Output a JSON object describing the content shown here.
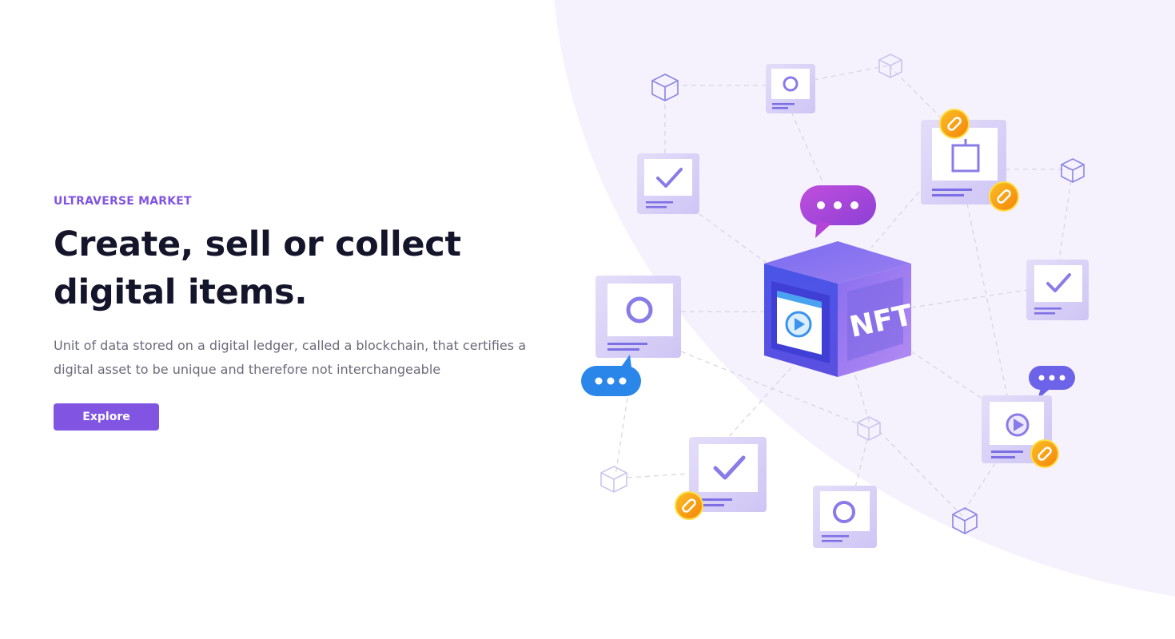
{
  "hero": {
    "eyebrow": "ULTRAVERSE MARKET",
    "headline_line1": "Create, sell or collect",
    "headline_line2": "digital items.",
    "description": "Unit of data stored on a digital ledger, called a blockchain, that certifies a digital asset to be unique and therefore not interchangeable",
    "explore_label": "Explore"
  },
  "illustration": {
    "cube_label": "NFT"
  },
  "colors": {
    "accent": "#8155e2",
    "headline": "#14142b",
    "body_text": "#6b6b7b",
    "background_blob": "#f5f2fd",
    "chat_blue": "#2b86ea",
    "chat_magenta": "#b545d6",
    "coin_orange": "#f7a21b"
  },
  "icons": [
    "chat-bubble-icon",
    "play-icon",
    "checkmark-icon",
    "circle-icon",
    "link-coin-icon",
    "cube-outline-icon",
    "frame-icon"
  ]
}
